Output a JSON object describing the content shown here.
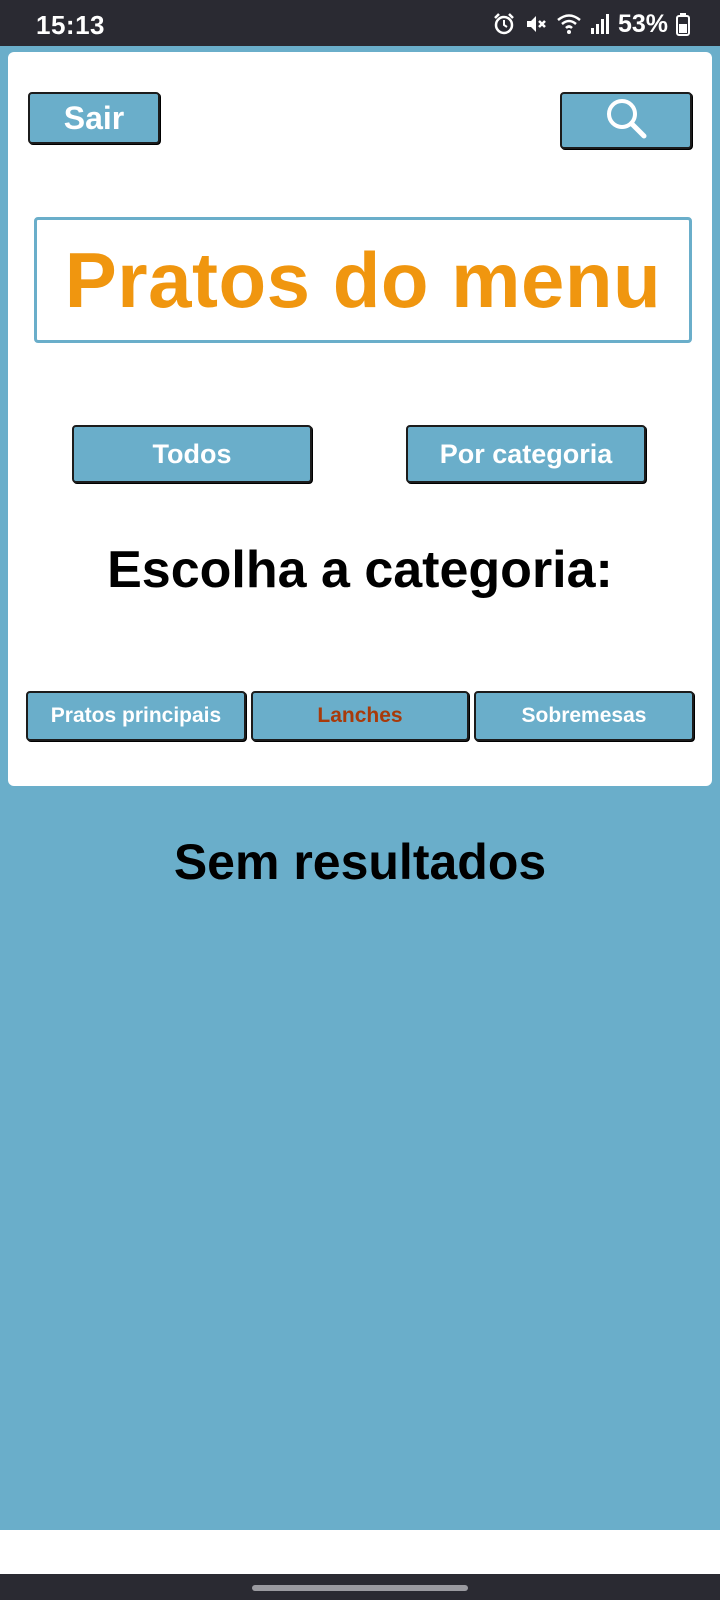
{
  "status_bar": {
    "time": "15:13",
    "battery": "53%",
    "icons": [
      "alarm-icon",
      "mute-icon",
      "wifi-icon",
      "signal-icon",
      "battery-icon"
    ]
  },
  "header": {
    "exit_label": "Sair",
    "search_icon": "search-icon"
  },
  "title": "Pratos do menu",
  "filters": {
    "all_label": "Todos",
    "by_category_label": "Por categoria"
  },
  "category_prompt": "Escolha a categoria:",
  "categories": [
    {
      "label": "Pratos principais",
      "selected": false
    },
    {
      "label": "Lanches",
      "selected": true
    },
    {
      "label": "Sobremesas",
      "selected": false
    }
  ],
  "results": {
    "empty_message": "Sem resultados"
  },
  "colors": {
    "background": "#6aaeca",
    "title": "#f0960f",
    "selected_category_text": "#a83a0a",
    "button_text": "#ffffff"
  }
}
